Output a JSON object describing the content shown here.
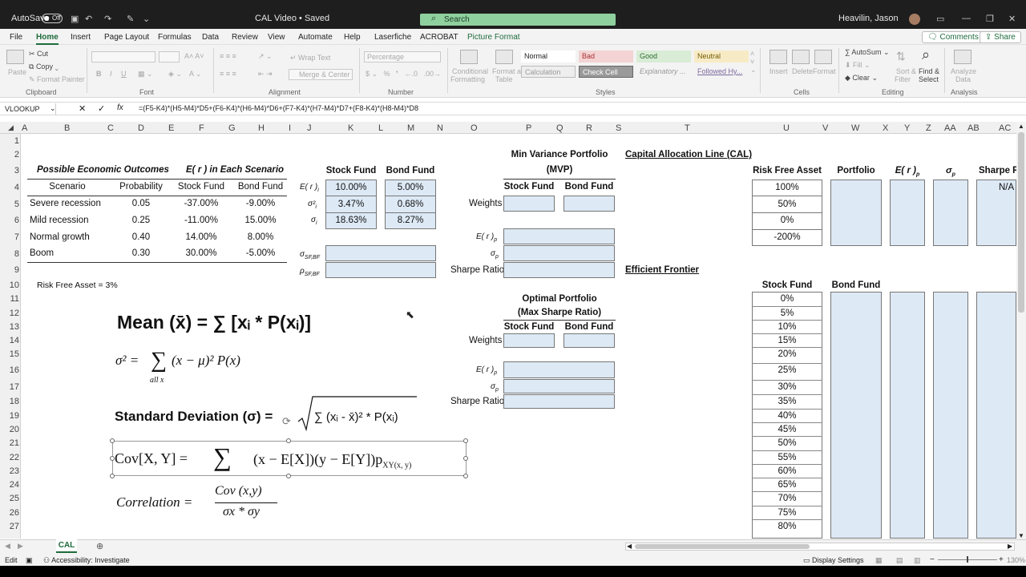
{
  "titlebar": {
    "autosave": "AutoSave",
    "toggle": "Off",
    "doc_title": "CAL Video • Saved",
    "search": "Search",
    "user": "Heavilin, Jason"
  },
  "menu": [
    "File",
    "Home",
    "Insert",
    "Page Layout",
    "Formulas",
    "Data",
    "Review",
    "View",
    "Automate",
    "Help",
    "Laserfiche",
    "ACROBAT",
    "Picture Format"
  ],
  "actions": {
    "comments": "Comments",
    "share": "Share"
  },
  "ribbon": {
    "paste": "Paste",
    "cut": "Cut",
    "copy": "Copy",
    "format_painter": "Format Painter",
    "clipboard": "Clipboard",
    "font": "Font",
    "bold": "B",
    "italic": "I",
    "underline": "U",
    "wrap_text": "Wrap Text",
    "merge_center": "Merge & Center",
    "alignment": "Alignment",
    "number_format": "Percentage",
    "number": "Number",
    "conditional": "Conditional",
    "formatting": "Formatting",
    "format_as": "Format as",
    "table": "Table",
    "style_normal": "Normal",
    "style_bad": "Bad",
    "style_good": "Good",
    "style_neutral": "Neutral",
    "style_calc": "Calculation",
    "style_check": "Check Cell",
    "style_expl": "Explanatory ...",
    "style_followed": "Followed Hy...",
    "styles": "Styles",
    "insert": "Insert",
    "delete": "Delete",
    "format": "Format",
    "cells": "Cells",
    "autosum": "AutoSum",
    "fill": "Fill",
    "clear": "Clear",
    "sort_filter": "Sort &",
    "filter": "Filter",
    "find_select": "Find &",
    "select": "Select",
    "editing": "Editing",
    "analyze": "Analyze",
    "analyze_data": "Data",
    "analysis": "Analysis"
  },
  "namebox": "VLOOKUP",
  "formula": "=(F5-K4)*(H5-M4)*D5+(F6-K4)*(H6-M4)*D6+(F7-K4)*(H7-M4)*D7+(F8-K4)*(H8-M4)*D8",
  "columns": [
    "A",
    "B",
    "C",
    "D",
    "E",
    "F",
    "G",
    "H",
    "I",
    "J",
    "K",
    "L",
    "M",
    "N",
    "O",
    "P",
    "Q",
    "R",
    "S",
    "T",
    "U",
    "V",
    "W",
    "X",
    "Y",
    "Z",
    "AA",
    "AB",
    "AC"
  ],
  "rows": [
    "1",
    "2",
    "3",
    "4",
    "5",
    "6",
    "7",
    "8",
    "9",
    "10",
    "11",
    "12",
    "13",
    "14",
    "15",
    "16",
    "17",
    "18",
    "19",
    "20",
    "21",
    "22",
    "23",
    "24",
    "25",
    "26",
    "27"
  ],
  "outcomes": {
    "title": "Possible Economic Outcomes",
    "scenario_title": "E( r ) in Each Scenario",
    "headers": [
      "Scenario",
      "Probability",
      "Stock Fund",
      "Bond Fund"
    ],
    "rows": [
      [
        "Severe recession",
        "0.05",
        "-37.00%",
        "-9.00%"
      ],
      [
        "Mild recession",
        "0.25",
        "-11.00%",
        "15.00%"
      ],
      [
        "Normal growth",
        "0.40",
        "14.00%",
        "8.00%"
      ],
      [
        "Boom",
        "0.30",
        "30.00%",
        "-5.00%"
      ]
    ],
    "risk_free": "Risk Free Asset = 3%"
  },
  "stats": {
    "headers": [
      "Stock Fund",
      "Bond Fund"
    ],
    "labels": [
      "E( r )",
      "σ²",
      "σ"
    ],
    "stock": [
      "10.00%",
      "3.47%",
      "18.63%"
    ],
    "bond": [
      "5.00%",
      "0.68%",
      "8.27%"
    ],
    "cov_label": "σ",
    "cov_sub": "SF,BF",
    "corr_label": "ρ",
    "corr_sub": "SF,BF"
  },
  "mvp": {
    "title1": "Min Variance Portfolio",
    "title2": "(MVP)",
    "headers": [
      "Stock Fund",
      "Bond Fund"
    ],
    "weights": "Weights",
    "er": "E( r )",
    "sigma": "σ",
    "sub": "p",
    "sharpe": "Sharpe Ratio"
  },
  "optimal": {
    "title1": "Optimal Portfolio",
    "title2": "(Max Sharpe Ratio)",
    "headers": [
      "Stock Fund",
      "Bond Fund"
    ],
    "weights": "Weights",
    "er": "E( r )",
    "sigma": "σ",
    "sub": "p",
    "sharpe": "Sharpe Ratio"
  },
  "cal": {
    "title": "Capital Allocation Line (CAL)",
    "headers": [
      "Risk Free Asset",
      "Portfolio",
      "E( r )",
      "σ",
      "Sharpe R"
    ],
    "sub": "p",
    "values": [
      "100%",
      "50%",
      "0%",
      "-200%"
    ],
    "na": "N/A"
  },
  "frontier": {
    "title": "Efficient Frontier",
    "headers": [
      "Stock Fund",
      "Bond Fund"
    ],
    "values": [
      "0%",
      "5%",
      "10%",
      "15%",
      "20%",
      "25%",
      "30%",
      "35%",
      "40%",
      "45%",
      "50%",
      "55%",
      "60%",
      "65%",
      "70%",
      "75%",
      "80%"
    ]
  },
  "formulas": {
    "mean": "Mean (x̄) = ∑ [xᵢ * P(xᵢ)]",
    "variance_lhs": "σ² =",
    "variance_rhs": "(x − μ)² P(x)",
    "all_x": "all x",
    "sd_lhs": "Standard Deviation (σ) =",
    "sd_rhs": "∑ (xᵢ - x̄)² * P(xᵢ)",
    "cov_lhs": "Cov[X, Y] =",
    "cov_rhs": "(x − E[X])(y − E[Y])p",
    "cov_tail": "XY(x, y)",
    "corr_lhs": "Correlation =",
    "corr_num": "Cov (x,y)",
    "corr_den": "σx * σy"
  },
  "sheet_tab": "CAL",
  "status": {
    "ready": "Edit",
    "accessibility": "Accessibility: Investigate",
    "display": "Display Settings",
    "zoom": "130%"
  }
}
